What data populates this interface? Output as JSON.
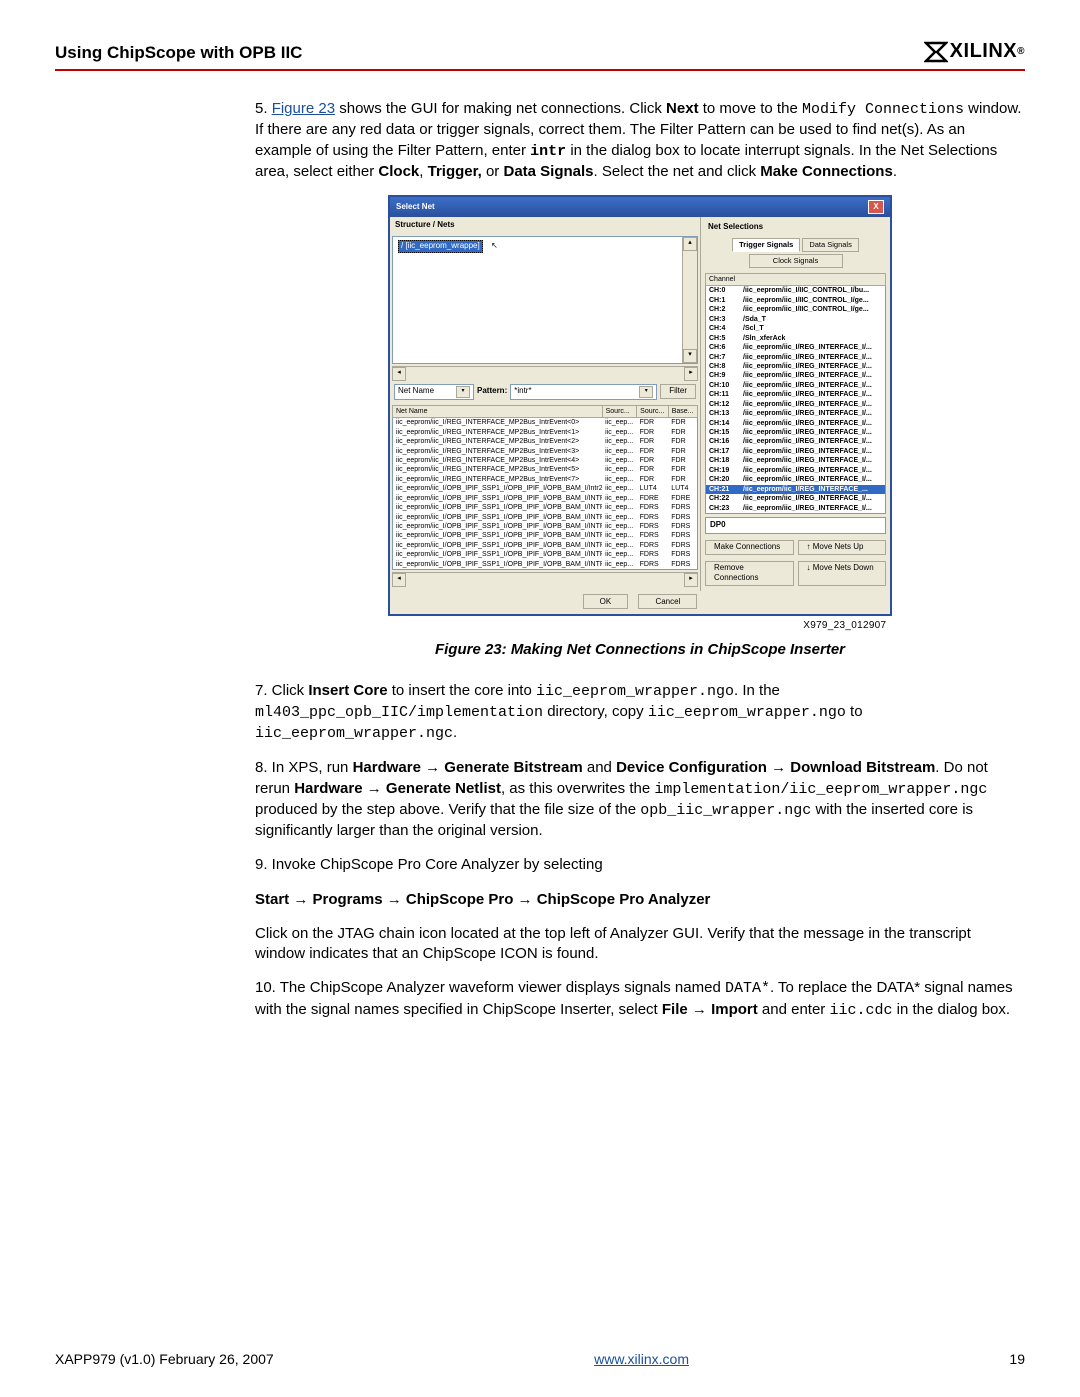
{
  "header": {
    "title": "Using ChipScope with OPB IIC",
    "brand_sigma": "Σ",
    "brand": "XILINX",
    "reg": "®"
  },
  "para5": {
    "num": "5. ",
    "figref": "Figure 23",
    "t1": " shows the GUI for making net connections. Click ",
    "next": "Next",
    "t2": " to move to the ",
    "modify": "Modify Connections",
    "t3": " window. If there are any red data or trigger signals, correct them. The Filter Pattern can be used to find net(s). As an example of using the Filter Pattern, enter ",
    "intr": "intr",
    "t4": " in the dialog box to locate interrupt signals. In the Net Selections area, select either ",
    "clock": "Clock",
    "comma": ", ",
    "trigger": "Trigger,",
    "t5": " or ",
    "data_signals": "Data Signals",
    "t6": ". Select the net and click ",
    "make_conn": "Make Connections",
    "period": "."
  },
  "dlg": {
    "title": "Select Net",
    "close": "X",
    "structure_nets": "Structure / Nets",
    "tree_item": "/ [iic_eeprom_wrappe]",
    "net_name_label": "Net Name",
    "pattern_label": "Pattern:",
    "pattern_value": "*intr*",
    "filter_btn": "Filter",
    "cols": [
      "Net Name",
      "Sourc...",
      "Sourc...",
      "Base..."
    ],
    "rows": [
      [
        "iic_eeprom/iic_I/REG_INTERFACE_MP2Bus_IntrEvent<0>",
        "iic_eep...",
        "FDR",
        "FDR"
      ],
      [
        "iic_eeprom/iic_I/REG_INTERFACE_MP2Bus_IntrEvent<1>",
        "iic_eep...",
        "FDR",
        "FDR"
      ],
      [
        "iic_eeprom/iic_I/REG_INTERFACE_MP2Bus_IntrEvent<2>",
        "iic_eep...",
        "FDR",
        "FDR"
      ],
      [
        "iic_eeprom/iic_I/REG_INTERFACE_MP2Bus_IntrEvent<3>",
        "iic_eep...",
        "FDR",
        "FDR"
      ],
      [
        "iic_eeprom/iic_I/REG_INTERFACE_MP2Bus_IntrEvent<4>",
        "iic_eep...",
        "FDR",
        "FDR"
      ],
      [
        "iic_eeprom/iic_I/REG_INTERFACE_MP2Bus_IntrEvent<5>",
        "iic_eep...",
        "FDR",
        "FDR"
      ],
      [
        "iic_eeprom/iic_I/REG_INTERFACE_MP2Bus_IntrEvent<7>",
        "iic_eep...",
        "FDR",
        "FDR"
      ],
      [
        "iic_eeprom/iic_I/OPB_IPIF_SSP1_I/OPB_IPIF_I/OPB_BAM_I/Intr2Bus...",
        "iic_eep...",
        "LUT4",
        "LUT4"
      ],
      [
        "iic_eeprom/iic_I/OPB_IPIF_SSP1_I/OPB_IPIF_I/OPB_BAM_I/INTR_CT...",
        "iic_eep...",
        "FDRE",
        "FDRE"
      ],
      [
        "iic_eeprom/iic_I/OPB_IPIF_SSP1_I/OPB_IPIF_I/OPB_BAM_I/INTR_CT...",
        "iic_eep...",
        "FDRS",
        "FDRS"
      ],
      [
        "iic_eeprom/iic_I/OPB_IPIF_SSP1_I/OPB_IPIF_I/OPB_BAM_I/INTR_CT...",
        "iic_eep...",
        "FDRS",
        "FDRS"
      ],
      [
        "iic_eeprom/iic_I/OPB_IPIF_SSP1_I/OPB_IPIF_I/OPB_BAM_I/INTR_CT...",
        "iic_eep...",
        "FDRS",
        "FDRS"
      ],
      [
        "iic_eeprom/iic_I/OPB_IPIF_SSP1_I/OPB_IPIF_I/OPB_BAM_I/INTR_CT...",
        "iic_eep...",
        "FDRS",
        "FDRS"
      ],
      [
        "iic_eeprom/iic_I/OPB_IPIF_SSP1_I/OPB_IPIF_I/OPB_BAM_I/INTR_CT...",
        "iic_eep...",
        "FDRS",
        "FDRS"
      ],
      [
        "iic_eeprom/iic_I/OPB_IPIF_SSP1_I/OPB_IPIF_I/OPB_BAM_I/INTR_CT...",
        "iic_eep...",
        "FDRS",
        "FDRS"
      ],
      [
        "iic_eeprom/iic_I/OPB_IPIF_SSP1_I/OPB_IPIF_I/OPB_BAM_I/INTR_CT...",
        "iic_eep...",
        "FDRS",
        "FDRS"
      ]
    ],
    "net_selections": "Net Selections",
    "tabs": {
      "trigger": "Trigger Signals",
      "data": "Data Signals",
      "clock": "Clock Signals"
    },
    "ch_header": "Channel",
    "channels": [
      [
        "CH:0",
        "/iic_eeprom/iic_I/IIC_CONTROL_I/bu..."
      ],
      [
        "CH:1",
        "/iic_eeprom/iic_I/IIC_CONTROL_I/ge..."
      ],
      [
        "CH:2",
        "/iic_eeprom/iic_I/IIC_CONTROL_I/ge..."
      ],
      [
        "CH:3",
        "/Sda_T"
      ],
      [
        "CH:4",
        "/Scl_T"
      ],
      [
        "CH:5",
        "/Sln_xferAck"
      ],
      [
        "CH:6",
        "/iic_eeprom/iic_I/REG_INTERFACE_I/..."
      ],
      [
        "CH:7",
        "/iic_eeprom/iic_I/REG_INTERFACE_I/..."
      ],
      [
        "CH:8",
        "/iic_eeprom/iic_I/REG_INTERFACE_I/..."
      ],
      [
        "CH:9",
        "/iic_eeprom/iic_I/REG_INTERFACE_I/..."
      ],
      [
        "CH:10",
        "/iic_eeprom/iic_I/REG_INTERFACE_I/..."
      ],
      [
        "CH:11",
        "/iic_eeprom/iic_I/REG_INTERFACE_I/..."
      ],
      [
        "CH:12",
        "/iic_eeprom/iic_I/REG_INTERFACE_I/..."
      ],
      [
        "CH:13",
        "/iic_eeprom/iic_I/REG_INTERFACE_I/..."
      ],
      [
        "CH:14",
        "/iic_eeprom/iic_I/REG_INTERFACE_I/..."
      ],
      [
        "CH:15",
        "/iic_eeprom/iic_I/REG_INTERFACE_I/..."
      ],
      [
        "CH:16",
        "/iic_eeprom/iic_I/REG_INTERFACE_I/..."
      ],
      [
        "CH:17",
        "/iic_eeprom/iic_I/REG_INTERFACE_I/..."
      ],
      [
        "CH:18",
        "/iic_eeprom/iic_I/REG_INTERFACE_I/..."
      ],
      [
        "CH:19",
        "/iic_eeprom/iic_I/REG_INTERFACE_I/..."
      ],
      [
        "CH:20",
        "/iic_eeprom/iic_I/REG_INTERFACE_I/..."
      ],
      [
        "CH:21",
        "/iic_eeprom/iic_I/REG_INTERFACE_..."
      ],
      [
        "CH:22",
        "/iic_eeprom/iic_I/REG_INTERFACE_I/..."
      ],
      [
        "CH:23",
        "/iic_eeprom/iic_I/REG_INTERFACE_I/..."
      ]
    ],
    "selected_ch": 21,
    "port": "DP0",
    "btns": {
      "make": "Make Connections",
      "up": "Move Nets Up",
      "remove": "Remove Connections",
      "down": "Move Nets Down"
    },
    "ok": "OK",
    "cancel": "Cancel"
  },
  "fig": {
    "id": "X979_23_012907",
    "caption_prefix": "Figure 23:  ",
    "caption": "Making Net Connections in ChipScope Inserter"
  },
  "para7": {
    "num": "7. Click ",
    "insert_core": "Insert Core",
    "t1": " to insert the core into ",
    "f1": "iic_eeprom_wrapper.ngo",
    "t2": ". In the ",
    "dir": "ml403_ppc_opb_IIC/implementation",
    "t3": " directory, copy ",
    "f2": "iic_eeprom_wrapper.ngo",
    "t4": " to ",
    "f3": "iic_eeprom_wrapper.ngc",
    "t5": "."
  },
  "para8": {
    "num": "8. In XPS, run ",
    "hw": "Hardware",
    "arrow": " → ",
    "gb": "Generate Bitstream",
    "and": " and ",
    "dc": "Device Configuration",
    "db": "Download Bitstream",
    "t1": ". Do not rerun ",
    "gn": "Generate Netlist",
    "t2": ", as this overwrites the ",
    "f1": "implementation/iic_eeprom_wrapper.ngc",
    "t3": " produced by the step above. Verify that the file size of the ",
    "f2": "opb_iic_wrapper.ngc",
    "t4": " with the inserted core is significantly larger than the original version."
  },
  "para9": {
    "text": "9. Invoke ChipScope Pro Core Analyzer by selecting",
    "path_parts": [
      "Start",
      "Programs",
      "ChipScope Pro",
      "ChipScope Pro Analyzer"
    ],
    "arrow": " → ",
    "t1": "Click on the JTAG chain icon located at the top left of Analyzer GUI. Verify that the message in the transcript window indicates that an ChipScope ICON is found."
  },
  "para10": {
    "t0": "10. The ChipScope Analyzer waveform viewer displays signals named ",
    "data_star": "DATA*",
    "t1": ". To replace the DATA* signal names with the signal names specified in ChipScope Inserter, select ",
    "file": "File",
    "arrow": " → ",
    "import": "Import",
    "t2": " and enter ",
    "cdc": "iic.cdc",
    "t3": " in the dialog box."
  },
  "footer": {
    "left": "XAPP979 (v1.0) February 26, 2007",
    "center_url": "www.xilinx.com",
    "right": "19"
  }
}
